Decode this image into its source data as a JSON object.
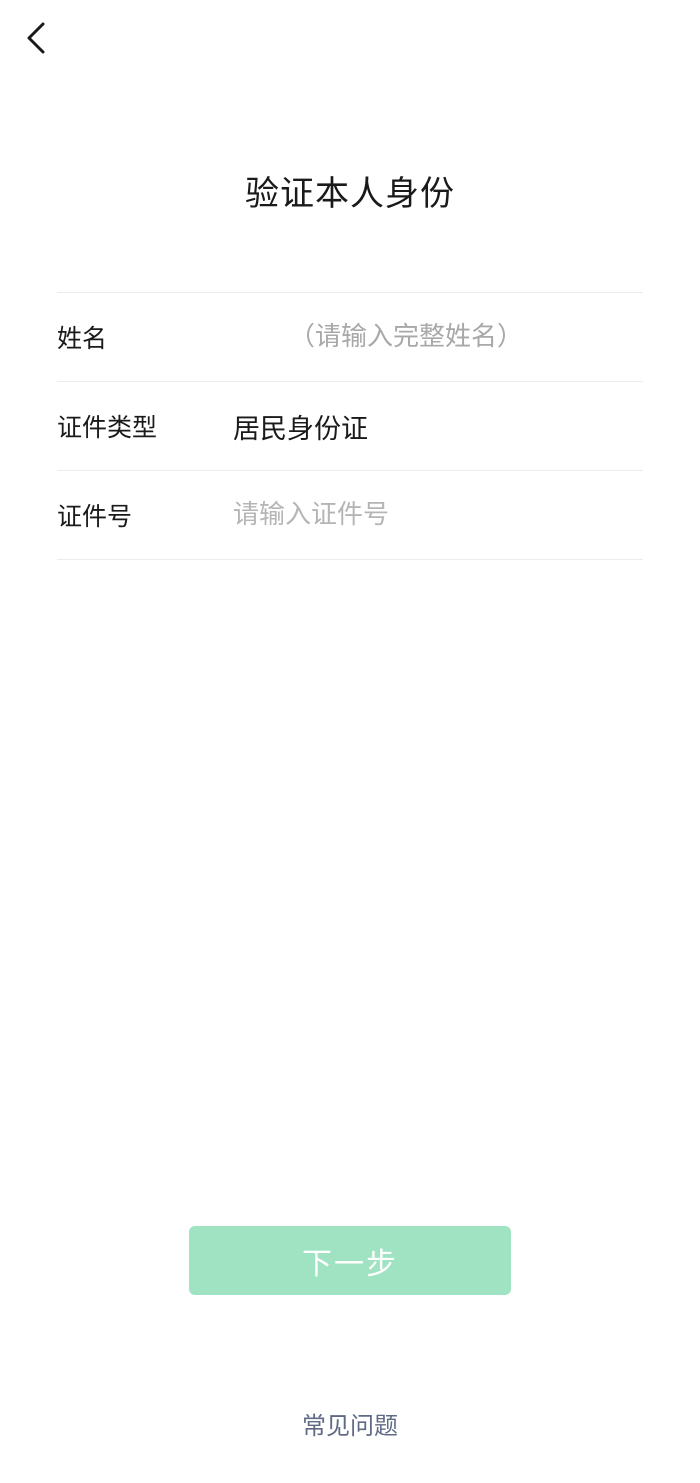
{
  "header": {
    "back_icon": "chevron-left-icon",
    "title": "验证本人身份"
  },
  "form": {
    "name": {
      "label": "姓名",
      "placeholder": "（请输入完整姓名）",
      "value": ""
    },
    "id_type": {
      "label": "证件类型",
      "value": "居民身份证"
    },
    "id_number": {
      "label": "证件号",
      "placeholder": "请输入证件号",
      "value": ""
    }
  },
  "actions": {
    "next_label": "下一步",
    "next_color": "#9fe3c2",
    "faq_label": "常见问题"
  }
}
